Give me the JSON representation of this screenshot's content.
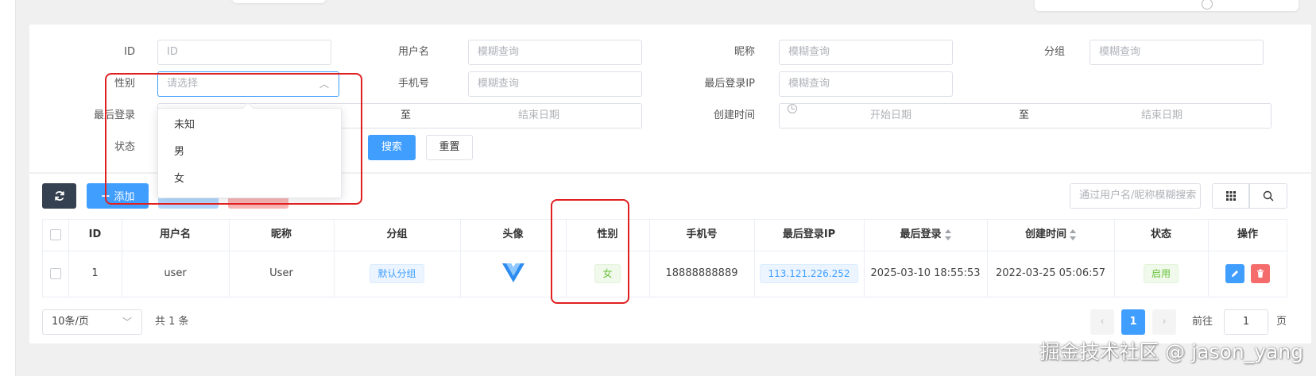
{
  "filters": {
    "id": {
      "label": "ID",
      "placeholder": "ID"
    },
    "username": {
      "label": "用户名",
      "placeholder": "模糊查询"
    },
    "nickname": {
      "label": "昵称",
      "placeholder": "模糊查询"
    },
    "group": {
      "label": "分组",
      "placeholder": "模糊查询"
    },
    "gender": {
      "label": "性别",
      "placeholder": "请选择",
      "options": [
        "未知",
        "男",
        "女"
      ]
    },
    "mobile": {
      "label": "手机号",
      "placeholder": "模糊查询"
    },
    "last_ip": {
      "label": "最后登录IP",
      "placeholder": "模糊查询"
    },
    "last_login": {
      "label": "最后登录",
      "separator": "至",
      "end_placeholder": "结束日期"
    },
    "create_time": {
      "label": "创建时间",
      "start_placeholder": "开始日期",
      "separator": "至",
      "end_placeholder": "结束日期"
    },
    "status": {
      "label": "状态"
    },
    "search_button": "搜索",
    "reset_button": "重置"
  },
  "toolbar": {
    "add_button": "添加",
    "quick_search_placeholder": "通过用户名/昵称模糊搜索"
  },
  "table": {
    "columns": [
      "ID",
      "用户名",
      "昵称",
      "分组",
      "头像",
      "性别",
      "手机号",
      "最后登录IP",
      "最后登录",
      "创建时间",
      "状态",
      "操作"
    ],
    "rows": [
      {
        "id": "1",
        "username": "user",
        "nickname": "User",
        "group": "默认分组",
        "gender": "女",
        "mobile": "18888888889",
        "last_ip": "113.121.226.252",
        "last_login": "2025-03-10 18:55:53",
        "create_time": "2022-03-25 05:06:57",
        "status": "启用"
      }
    ]
  },
  "pagination": {
    "page_size": "10条/页",
    "total": "共 1 条",
    "current_page": "1",
    "goto_label": "前往",
    "goto_value": "1",
    "page_suffix": "页"
  },
  "watermark": "掘金技术社区 @ jason_yang",
  "colors": {
    "primary": "#409eff",
    "danger": "#f56c6c",
    "success": "#67c23a",
    "annotation": "#e02020"
  }
}
